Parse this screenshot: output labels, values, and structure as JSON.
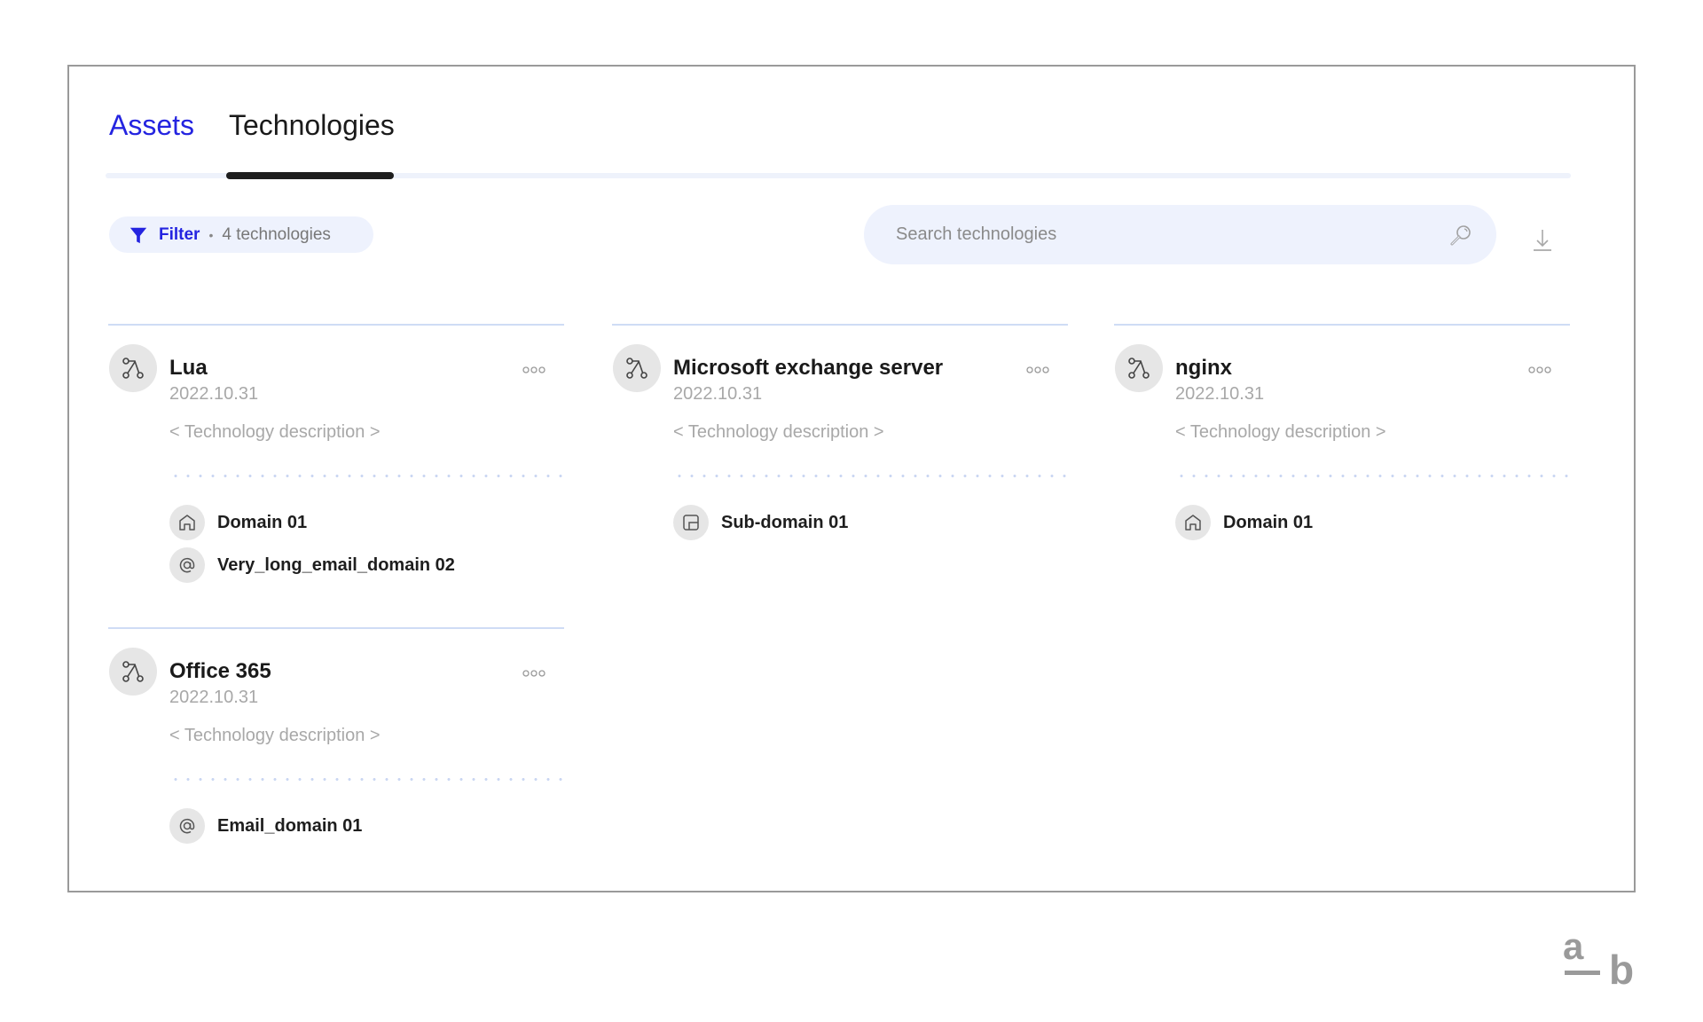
{
  "tabs": [
    {
      "label": "Assets",
      "active": false
    },
    {
      "label": "Technologies",
      "active": true
    }
  ],
  "toolbar": {
    "filter_label": "Filter",
    "filter_separator": "•",
    "filter_count": "4 technologies",
    "search_placeholder": "Search technologies",
    "search_value": ""
  },
  "colors": {
    "accent": "#2424e0",
    "pill_bg": "#eef2fd",
    "card_rule": "#cfdcf5",
    "muted_text": "#a8a8a8"
  },
  "technologies": [
    {
      "name": "Lua",
      "date": "2022.10.31",
      "description": "< Technology description >",
      "icon": "git-branch-icon",
      "assets": [
        {
          "type": "domain",
          "icon": "home-icon",
          "label": "Domain 01"
        },
        {
          "type": "email",
          "icon": "at-icon",
          "label": "Very_long_email_domain 02"
        }
      ]
    },
    {
      "name": "Microsoft exchange server",
      "date": "2022.10.31",
      "description": "< Technology description >",
      "icon": "git-branch-icon",
      "assets": [
        {
          "type": "subdomain",
          "icon": "subdomain-icon",
          "label": "Sub-domain 01"
        }
      ]
    },
    {
      "name": "nginx",
      "date": "2022.10.31",
      "description": "< Technology description >",
      "icon": "git-branch-icon",
      "assets": [
        {
          "type": "domain",
          "icon": "home-icon",
          "label": "Domain 01"
        }
      ]
    },
    {
      "name": "Office 365",
      "date": "2022.10.31",
      "description": "< Technology description >",
      "icon": "git-branch-icon",
      "assets": [
        {
          "type": "email",
          "icon": "at-icon",
          "label": "Email_domain 01"
        }
      ]
    }
  ],
  "logo": {
    "top": "a",
    "bottom": "b"
  }
}
